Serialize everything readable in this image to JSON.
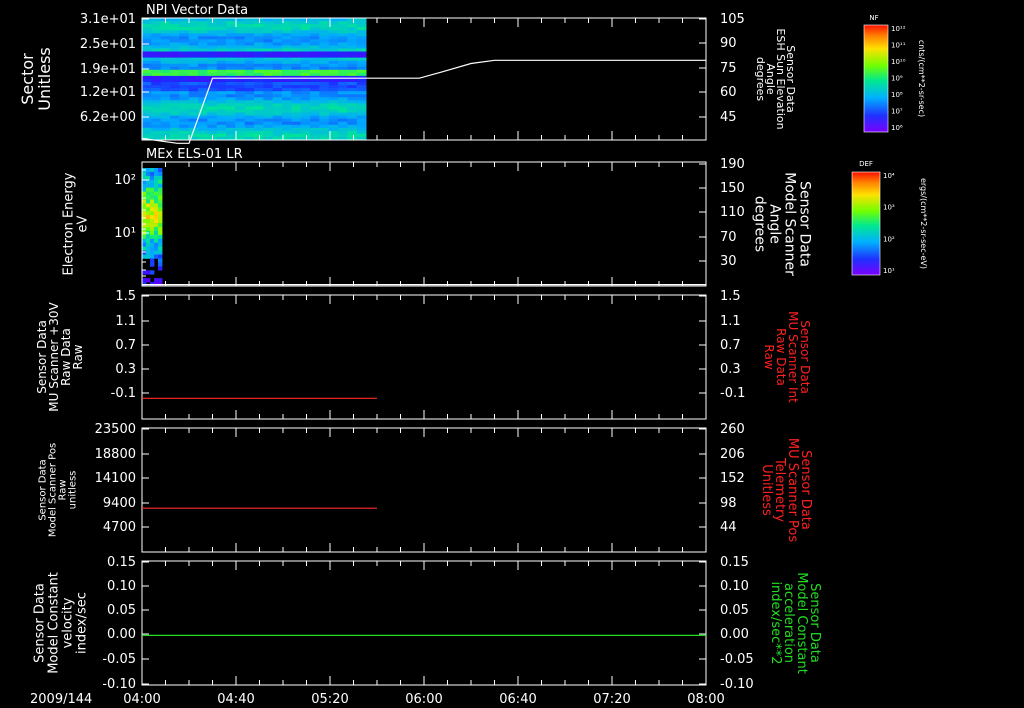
{
  "chart_data": [
    {
      "type": "heatmap",
      "title": "NPI Vector Data",
      "ylabel_left": [
        "Sector",
        "Unitless"
      ],
      "y_ticks_left": [
        "3.1e+01",
        "2.5e+01",
        "1.9e+01",
        "1.2e+01",
        "6.2e+00"
      ],
      "ylabel_right": [
        "Sensor Data",
        "ESH Sun Elevation",
        "Angle",
        "degrees"
      ],
      "y_ticks_right": [
        "105",
        "90",
        "75",
        "60",
        "45"
      ],
      "ylim_right": [
        30,
        105
      ],
      "heatmap_extent_x": [
        "04:00",
        "05:37"
      ],
      "line_series": {
        "name": "ESH Sun Elevation Angle",
        "x_minutes": [
          0,
          15,
          20,
          25,
          30,
          80,
          108,
          118,
          128,
          140,
          150,
          180,
          240
        ],
        "y": [
          31,
          28,
          28,
          48,
          68,
          68,
          68,
          68,
          72,
          77,
          79,
          79,
          79
        ]
      }
    },
    {
      "type": "heatmap",
      "title": "MEx ELS-01 LR",
      "ylabel_left": [
        "Electron Energy",
        "eV"
      ],
      "y_ticks_left": [
        "10²",
        "10¹"
      ],
      "ylabel_right": [
        "Sensor Data",
        "Model Scanner",
        "Angle",
        "degrees"
      ],
      "y_ticks_right": [
        "190",
        "150",
        "110",
        "70",
        "30"
      ],
      "ylim_right": [
        10,
        190
      ],
      "heatmap_extent_x": [
        "04:00",
        "04:07"
      ],
      "line_series": {
        "name": "Model Scanner Angle",
        "x_minutes": [
          0,
          240
        ],
        "y": [
          12,
          12
        ]
      }
    },
    {
      "type": "line",
      "ylabel_left": [
        "Sensor Data",
        "MU Scanner +30V",
        "Raw Data",
        "Raw"
      ],
      "y_ticks_left": [
        "1.5",
        "1.1",
        "0.7",
        "0.3",
        "-0.1"
      ],
      "ylabel_right": [
        "Sensor Data",
        "MU Scanner Int",
        "Raw Data",
        "Raw"
      ],
      "y_ticks_right": [
        "1.5",
        "1.1",
        "0.7",
        "0.3",
        "-0.1"
      ],
      "ylim": [
        -0.3,
        1.5
      ],
      "series": [
        {
          "x_minutes": [
            0,
            100
          ],
          "y": [
            0.0,
            0.0
          ],
          "color": "#ff2a2a"
        }
      ]
    },
    {
      "type": "line",
      "ylabel_left": [
        "Sensor Data",
        "Model Scanner Pos",
        "Raw",
        "unitless"
      ],
      "y_ticks_left": [
        "23500",
        "18800",
        "14100",
        "9400",
        "4700"
      ],
      "ylabel_right": [
        "Sensor Data",
        "MU Scanner Pos",
        "Telemetry",
        "Unitless"
      ],
      "y_ticks_right": [
        "260",
        "206",
        "152",
        "98",
        "44"
      ],
      "ylim": [
        0,
        23500
      ],
      "series": [
        {
          "x_minutes": [
            0,
            100
          ],
          "y": [
            8300,
            8300
          ],
          "color": "#ff2a2a"
        }
      ]
    },
    {
      "type": "line",
      "ylabel_left": [
        "Sensor Data",
        "Model Constant",
        "velocity",
        "index/sec"
      ],
      "y_ticks_left": [
        "0.15",
        "0.10",
        "0.05",
        "0.00",
        "-0.05",
        "-0.10"
      ],
      "ylabel_right": [
        "Sensor Data",
        "Model Constant",
        "acceleration",
        "index/sec**2"
      ],
      "y_ticks_right": [
        "0.15",
        "0.10",
        "0.05",
        "0.00",
        "-0.05",
        "-0.10"
      ],
      "ylim": [
        -0.1,
        0.15
      ],
      "series": [
        {
          "x_minutes": [
            0,
            240
          ],
          "y": [
            0.0,
            0.0
          ],
          "color": "#22dd22"
        }
      ]
    }
  ],
  "x_axis": {
    "date_label": "2009/144",
    "tick_labels": [
      "04:00",
      "04:40",
      "05:20",
      "06:00",
      "06:40",
      "07:20",
      "08:00"
    ]
  },
  "colorbars": [
    {
      "label": "NF",
      "unit": "cnts/(cm**2-sr-sec)",
      "ticks": [
        "10¹²",
        "10¹¹",
        "10¹⁰",
        "10⁹",
        "10⁸",
        "10⁷",
        "10⁶"
      ]
    },
    {
      "label": "DEF",
      "unit": "ergs/(cm**2-sr-sec-eV)",
      "ticks": [
        "10⁴",
        "10³",
        "10²",
        "10¹"
      ]
    }
  ],
  "colors": {
    "axes": "#ffffff",
    "right_label_red": "#ff2020",
    "right_label_green": "#22dd22",
    "curve": "#ffffff"
  }
}
